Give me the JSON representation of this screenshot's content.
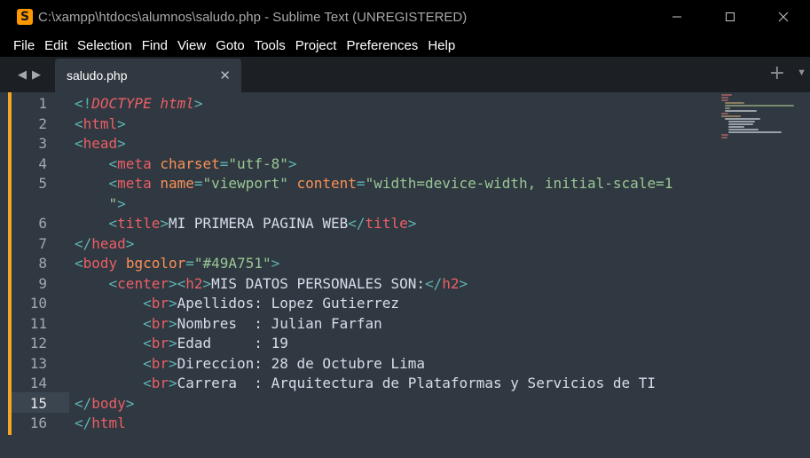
{
  "window": {
    "title": "C:\\xampp\\htdocs\\alumnos\\saludo.php - Sublime Text (UNREGISTERED)",
    "app_icon_glyph": "S",
    "minimize_glyph": "—",
    "maximize_glyph": "☐",
    "close_glyph": "✕"
  },
  "menu": {
    "items": [
      "File",
      "Edit",
      "Selection",
      "Find",
      "View",
      "Goto",
      "Tools",
      "Project",
      "Preferences",
      "Help"
    ]
  },
  "tabs": {
    "nav_back_glyph": "◀",
    "nav_forward_glyph": "▶",
    "active_tab_label": "saludo.php",
    "close_glyph": "✕",
    "new_tab_glyph": "+",
    "dropdown_glyph": "▼"
  },
  "editor": {
    "line_numbers": [
      "1",
      "2",
      "3",
      "4",
      "5",
      "",
      "6",
      "7",
      "8",
      "9",
      "10",
      "11",
      "12",
      "13",
      "14",
      "15",
      "16"
    ],
    "active_line": "15",
    "colors": {
      "background": "#303841",
      "tag": "#ec5f66",
      "attribute": "#f99157",
      "string": "#99c794",
      "punctuation": "#5fb3b3",
      "text": "#d8dee9",
      "modified_marker": "#f5a623"
    },
    "code": {
      "l1": {
        "open": "<!",
        "doctype": "DOCTYPE",
        "sp": " ",
        "name": "html",
        "close": ">"
      },
      "l2": {
        "open": "<",
        "tag": "html",
        "close": ">"
      },
      "l3": {
        "open": "<",
        "tag": "head",
        "close": ">"
      },
      "l4": {
        "indent": "    ",
        "open": "<",
        "tag": "meta",
        "sp": " ",
        "attr": "charset",
        "eq": "=",
        "val": "\"utf-8\"",
        "close": ">"
      },
      "l5": {
        "indent": "    ",
        "open": "<",
        "tag": "meta",
        "sp1": " ",
        "attr1": "name",
        "eq1": "=",
        "val1": "\"viewport\"",
        "sp2": " ",
        "attr2": "content",
        "eq2": "=",
        "val2": "\"width=device-width, initial-scale=1"
      },
      "l5b": {
        "indent": "    ",
        "val": "\"",
        "close": ">"
      },
      "l6": {
        "indent": "    ",
        "open": "<",
        "tag": "title",
        "close": ">",
        "text": "MI PRIMERA PAGINA WEB",
        "open2": "</",
        "tag2": "title",
        "close2": ">"
      },
      "l7": {
        "open": "</",
        "tag": "head",
        "close": ">"
      },
      "l8": {
        "open": "<",
        "tag": "body",
        "sp": " ",
        "attr": "bgcolor",
        "eq": "=",
        "val": "\"#49A751\"",
        "close": ">"
      },
      "l9": {
        "indent": "    ",
        "open": "<",
        "tag": "center",
        "close": ">",
        "open2": "<",
        "tag2": "h2",
        "close2": ">",
        "text": "MIS DATOS PERSONALES SON:",
        "open3": "</",
        "tag3": "h2",
        "close3": ">"
      },
      "l10": {
        "indent": "        ",
        "open": "<",
        "tag": "br",
        "close": ">",
        "text": "Apellidos: Lopez Gutierrez"
      },
      "l11": {
        "indent": "        ",
        "open": "<",
        "tag": "br",
        "close": ">",
        "text": "Nombres  : Julian Farfan"
      },
      "l12": {
        "indent": "        ",
        "open": "<",
        "tag": "br",
        "close": ">",
        "text": "Edad     : 19"
      },
      "l13": {
        "indent": "        ",
        "open": "<",
        "tag": "br",
        "close": ">",
        "text": "Direccion: 28 de Octubre Lima"
      },
      "l14": {
        "indent": "        ",
        "open": "<",
        "tag": "br",
        "close": ">",
        "text": "Carrera  : Arquitectura de Plataformas y Servicios de TI"
      },
      "l15": {
        "open": "</",
        "tag": "body",
        "close": ">"
      },
      "l16": {
        "open": "</",
        "tag": "html"
      }
    }
  }
}
